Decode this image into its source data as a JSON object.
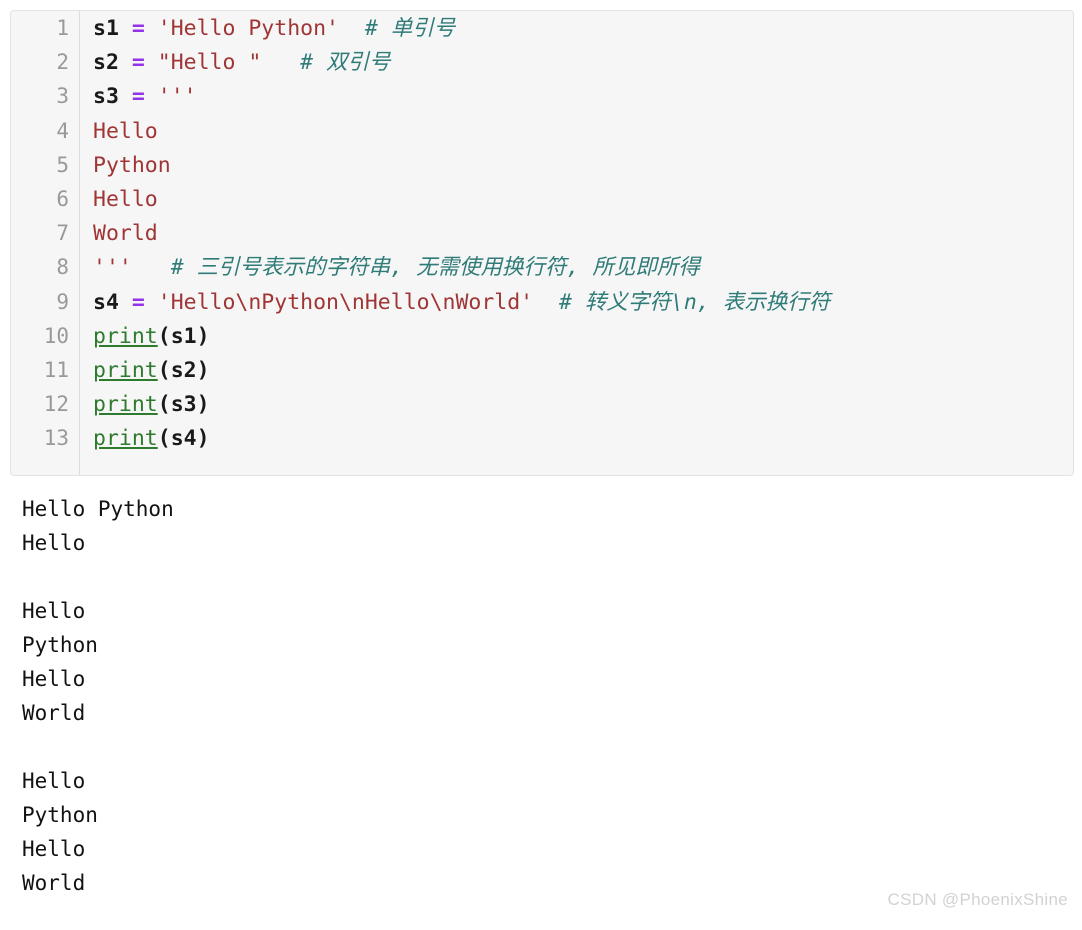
{
  "code_block": {
    "language": "python",
    "background_color": "#f6f6f6",
    "border_color": "#e3e3e3",
    "gutter_color": "#999999",
    "colors": {
      "string": "#a03535",
      "operator": "#9333e8",
      "comment": "#2f7b78",
      "builtin": "#2e7b2e",
      "identifier": "#1a1a1a"
    },
    "lines": [
      {
        "number": "1",
        "tokens": [
          {
            "t": "var",
            "v": "s1"
          },
          {
            "t": "plain",
            "v": " "
          },
          {
            "t": "op",
            "v": "="
          },
          {
            "t": "plain",
            "v": " "
          },
          {
            "t": "str",
            "v": "'Hello Python'"
          },
          {
            "t": "plain",
            "v": "  "
          },
          {
            "t": "cmt",
            "v": "# 单引号"
          }
        ]
      },
      {
        "number": "2",
        "tokens": [
          {
            "t": "var",
            "v": "s2"
          },
          {
            "t": "plain",
            "v": " "
          },
          {
            "t": "op",
            "v": "="
          },
          {
            "t": "plain",
            "v": " "
          },
          {
            "t": "str",
            "v": "\"Hello \""
          },
          {
            "t": "plain",
            "v": "   "
          },
          {
            "t": "cmt",
            "v": "# 双引号"
          }
        ]
      },
      {
        "number": "3",
        "tokens": [
          {
            "t": "var",
            "v": "s3"
          },
          {
            "t": "plain",
            "v": " "
          },
          {
            "t": "op",
            "v": "="
          },
          {
            "t": "plain",
            "v": " "
          },
          {
            "t": "str",
            "v": "'''"
          }
        ]
      },
      {
        "number": "4",
        "tokens": [
          {
            "t": "str",
            "v": "Hello"
          }
        ]
      },
      {
        "number": "5",
        "tokens": [
          {
            "t": "str",
            "v": "Python"
          }
        ]
      },
      {
        "number": "6",
        "tokens": [
          {
            "t": "str",
            "v": "Hello"
          }
        ]
      },
      {
        "number": "7",
        "tokens": [
          {
            "t": "str",
            "v": "World"
          }
        ]
      },
      {
        "number": "8",
        "tokens": [
          {
            "t": "str",
            "v": "'''"
          },
          {
            "t": "plain",
            "v": "   "
          },
          {
            "t": "cmt",
            "v": "# 三引号表示的字符串, 无需使用换行符, 所见即所得"
          }
        ]
      },
      {
        "number": "9",
        "tokens": [
          {
            "t": "var",
            "v": "s4"
          },
          {
            "t": "plain",
            "v": " "
          },
          {
            "t": "op",
            "v": "="
          },
          {
            "t": "plain",
            "v": " "
          },
          {
            "t": "str",
            "v": "'Hello\\nPython\\nHello\\nWorld'"
          },
          {
            "t": "plain",
            "v": "  "
          },
          {
            "t": "cmt",
            "v": "# 转义字符\\n, 表示换行符"
          }
        ]
      },
      {
        "number": "10",
        "tokens": [
          {
            "t": "fn",
            "v": "print"
          },
          {
            "t": "plain",
            "v": "("
          },
          {
            "t": "var",
            "v": "s1"
          },
          {
            "t": "plain",
            "v": ")"
          }
        ]
      },
      {
        "number": "11",
        "tokens": [
          {
            "t": "fn",
            "v": "print"
          },
          {
            "t": "plain",
            "v": "("
          },
          {
            "t": "var",
            "v": "s2"
          },
          {
            "t": "plain",
            "v": ")"
          }
        ]
      },
      {
        "number": "12",
        "tokens": [
          {
            "t": "fn",
            "v": "print"
          },
          {
            "t": "plain",
            "v": "("
          },
          {
            "t": "var",
            "v": "s3"
          },
          {
            "t": "plain",
            "v": ")"
          }
        ]
      },
      {
        "number": "13",
        "tokens": [
          {
            "t": "fn",
            "v": "print"
          },
          {
            "t": "plain",
            "v": "("
          },
          {
            "t": "var",
            "v": "s4"
          },
          {
            "t": "plain",
            "v": ")"
          }
        ]
      }
    ]
  },
  "output": {
    "lines": [
      "Hello Python",
      "Hello",
      "",
      "Hello",
      "Python",
      "Hello",
      "World",
      "",
      "Hello",
      "Python",
      "Hello",
      "World"
    ]
  },
  "watermark": {
    "text": "CSDN @PhoenixShine",
    "color": "#d2d2d2"
  }
}
